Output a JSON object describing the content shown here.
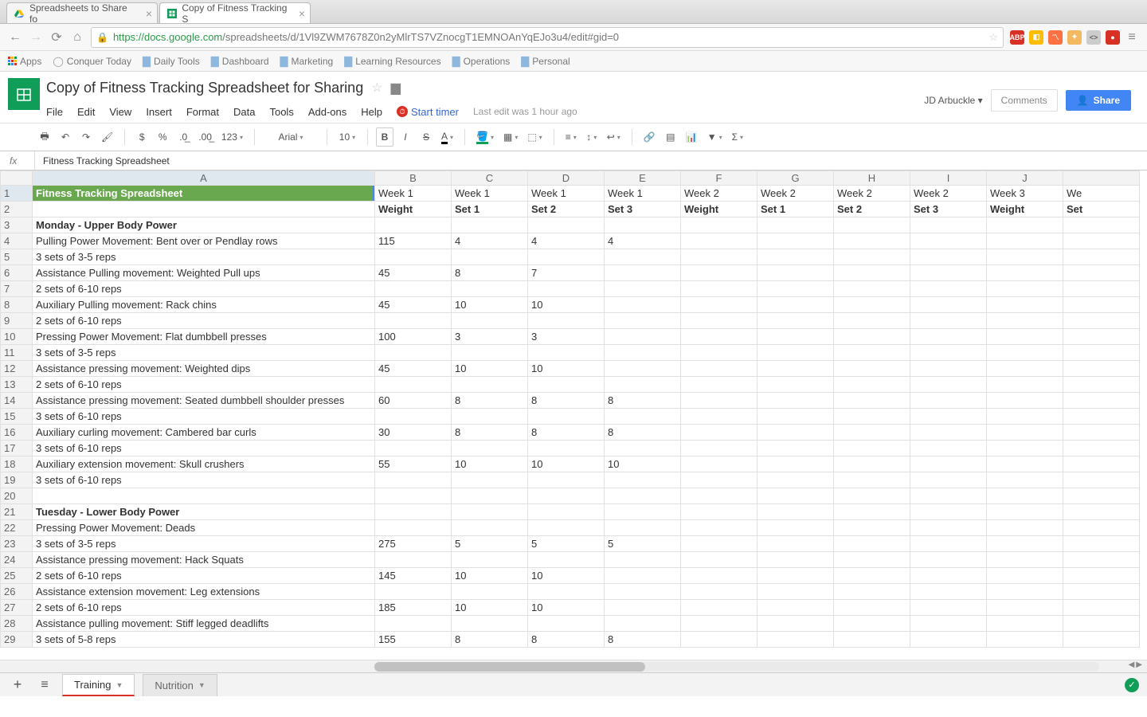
{
  "browser": {
    "tabs": [
      {
        "title": "Spreadsheets to Share fo",
        "active": false
      },
      {
        "title": "Copy of Fitness Tracking S",
        "active": true
      }
    ],
    "url_host": "https",
    "url_domain": "://docs.google.com",
    "url_path": "/spreadsheets/d/1Vl9ZWM7678Z0n2yMlrTS7VZnocgT1EMNOAnYqEJo3u4/edit#gid=0",
    "bookmarks": [
      "Apps",
      "Conquer Today",
      "Daily Tools",
      "Dashboard",
      "Marketing",
      "Learning Resources",
      "Operations",
      "Personal"
    ]
  },
  "doc": {
    "title": "Copy of Fitness Tracking Spreadsheet for Sharing",
    "menus": [
      "File",
      "Edit",
      "View",
      "Insert",
      "Format",
      "Data",
      "Tools",
      "Add-ons",
      "Help"
    ],
    "start_timer": "Start timer",
    "last_edit": "Last edit was 1 hour ago",
    "user": "JD Arbuckle",
    "comments": "Comments",
    "share": "Share",
    "font": "Arial",
    "font_size": "10",
    "formula_cell": "Fitness Tracking Spreadsheet"
  },
  "columns": [
    "A",
    "B",
    "C",
    "D",
    "E",
    "F",
    "G",
    "H",
    "I",
    "J",
    ""
  ],
  "rows": [
    {
      "n": 1,
      "a": "Fitness Tracking Spreadsheet",
      "title": true,
      "cells": [
        "Week 1",
        "Week 1",
        "Week 1",
        "Week 1",
        "Week 2",
        "Week 2",
        "Week 2",
        "Week 2",
        "Week 3",
        "We"
      ],
      "bold": true
    },
    {
      "n": 2,
      "a": "",
      "cells": [
        "Weight",
        "Set 1",
        "Set 2",
        "Set 3",
        "Weight",
        "Set 1",
        "Set 2",
        "Set 3",
        "Weight",
        "Set"
      ],
      "bold": true
    },
    {
      "n": 3,
      "a": "Monday - Upper Body Power",
      "bold": true,
      "cells": [
        "",
        "",
        "",
        "",
        "",
        "",
        "",
        "",
        "",
        ""
      ]
    },
    {
      "n": 4,
      "a": "Pulling Power Movement: Bent over or Pendlay rows",
      "cells": [
        "115",
        "4",
        "4",
        "4",
        "",
        "",
        "",
        "",
        "",
        ""
      ]
    },
    {
      "n": 5,
      "a": "3 sets of 3-5 reps",
      "cells": [
        "",
        "",
        "",
        "",
        "",
        "",
        "",
        "",
        "",
        ""
      ]
    },
    {
      "n": 6,
      "a": "Assistance Pulling movement: Weighted Pull ups",
      "cells": [
        "45",
        "8",
        "7",
        "",
        "",
        "",
        "",
        "",
        "",
        ""
      ]
    },
    {
      "n": 7,
      "a": "2 sets of 6-10 reps",
      "cells": [
        "",
        "",
        "",
        "",
        "",
        "",
        "",
        "",
        "",
        ""
      ]
    },
    {
      "n": 8,
      "a": "Auxiliary Pulling movement: Rack chins",
      "cells": [
        "45",
        "10",
        "10",
        "",
        "",
        "",
        "",
        "",
        "",
        ""
      ]
    },
    {
      "n": 9,
      "a": "2 sets of 6-10 reps",
      "cells": [
        "",
        "",
        "",
        "",
        "",
        "",
        "",
        "",
        "",
        ""
      ]
    },
    {
      "n": 10,
      "a": "Pressing Power Movement: Flat dumbbell presses",
      "cells": [
        "100",
        "3",
        "3",
        "",
        "",
        "",
        "",
        "",
        "",
        ""
      ]
    },
    {
      "n": 11,
      "a": "3 sets of 3-5 reps",
      "cells": [
        "",
        "",
        "",
        "",
        "",
        "",
        "",
        "",
        "",
        ""
      ]
    },
    {
      "n": 12,
      "a": "Assistance pressing movement: Weighted dips",
      "cells": [
        "45",
        "10",
        "10",
        "",
        "",
        "",
        "",
        "",
        "",
        ""
      ]
    },
    {
      "n": 13,
      "a": "2 sets of 6-10 reps",
      "cells": [
        "",
        "",
        "",
        "",
        "",
        "",
        "",
        "",
        "",
        ""
      ]
    },
    {
      "n": 14,
      "a": "Assistance pressing movement: Seated dumbbell shoulder presses",
      "cells": [
        "60",
        "8",
        "8",
        "8",
        "",
        "",
        "",
        "",
        "",
        ""
      ]
    },
    {
      "n": 15,
      "a": "3 sets of 6-10 reps",
      "cells": [
        "",
        "",
        "",
        "",
        "",
        "",
        "",
        "",
        "",
        ""
      ]
    },
    {
      "n": 16,
      "a": "Auxiliary curling movement: Cambered bar curls",
      "cells": [
        "30",
        "8",
        "8",
        "8",
        "",
        "",
        "",
        "",
        "",
        ""
      ]
    },
    {
      "n": 17,
      "a": "3 sets of 6-10 reps",
      "cells": [
        "",
        "",
        "",
        "",
        "",
        "",
        "",
        "",
        "",
        ""
      ]
    },
    {
      "n": 18,
      "a": "Auxiliary extension movement: Skull crushers",
      "cells": [
        "55",
        "10",
        "10",
        "10",
        "",
        "",
        "",
        "",
        "",
        ""
      ]
    },
    {
      "n": 19,
      "a": "3 sets of 6-10 reps",
      "cells": [
        "",
        "",
        "",
        "",
        "",
        "",
        "",
        "",
        "",
        ""
      ]
    },
    {
      "n": 20,
      "a": "",
      "cells": [
        "",
        "",
        "",
        "",
        "",
        "",
        "",
        "",
        "",
        ""
      ]
    },
    {
      "n": 21,
      "a": "Tuesday - Lower Body Power",
      "bold": true,
      "cells": [
        "",
        "",
        "",
        "",
        "",
        "",
        "",
        "",
        "",
        ""
      ]
    },
    {
      "n": 22,
      "a": "Pressing Power Movement: Deads",
      "cells": [
        "",
        "",
        "",
        "",
        "",
        "",
        "",
        "",
        "",
        ""
      ]
    },
    {
      "n": 23,
      "a": "3 sets of 3-5 reps",
      "cells": [
        "275",
        "5",
        "5",
        "5",
        "",
        "",
        "",
        "",
        "",
        ""
      ]
    },
    {
      "n": 24,
      "a": "Assistance pressing movement: Hack Squats",
      "cells": [
        "",
        "",
        "",
        "",
        "",
        "",
        "",
        "",
        "",
        ""
      ]
    },
    {
      "n": 25,
      "a": "2 sets of 6-10 reps",
      "cells": [
        "145",
        "10",
        "10",
        "",
        "",
        "",
        "",
        "",
        "",
        ""
      ]
    },
    {
      "n": 26,
      "a": "Assistance extension movement: Leg extensions",
      "cells": [
        "",
        "",
        "",
        "",
        "",
        "",
        "",
        "",
        "",
        ""
      ]
    },
    {
      "n": 27,
      "a": "2 sets of 6-10 reps",
      "cells": [
        "185",
        "10",
        "10",
        "",
        "",
        "",
        "",
        "",
        "",
        ""
      ]
    },
    {
      "n": 28,
      "a": "Assistance pulling movement: Stiff legged deadlifts",
      "cells": [
        "",
        "",
        "",
        "",
        "",
        "",
        "",
        "",
        "",
        ""
      ]
    },
    {
      "n": 29,
      "a": "3 sets of 5-8 reps",
      "cells": [
        "155",
        "8",
        "8",
        "8",
        "",
        "",
        "",
        "",
        "",
        ""
      ]
    }
  ],
  "sheets": {
    "active": "Training",
    "inactive": "Nutrition"
  }
}
